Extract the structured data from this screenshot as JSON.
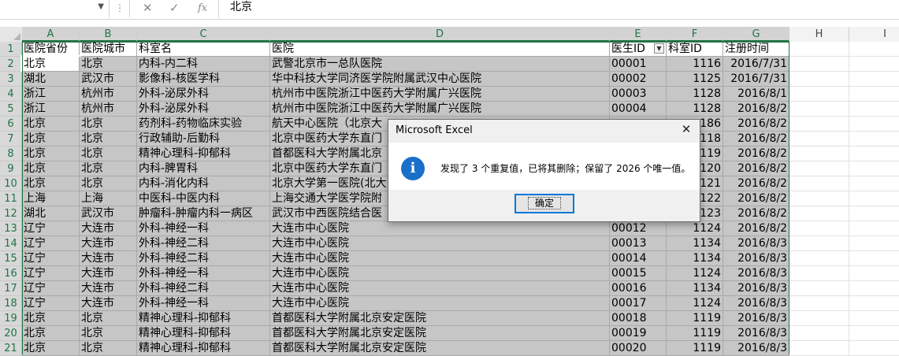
{
  "formula_bar": {
    "name_box": "",
    "cancel_icon": "close-icon",
    "enter_icon": "check-icon",
    "function_label": "fx",
    "value": "北京"
  },
  "columns": [
    "A",
    "B",
    "C",
    "D",
    "E",
    "F",
    "G",
    "H",
    "I"
  ],
  "header_row": {
    "row_num": "1",
    "cells": [
      "医院省份",
      "医院城市",
      "科室名",
      "医院",
      "医生ID",
      "科室ID",
      "注册时间"
    ]
  },
  "rows": [
    {
      "n": "2",
      "c": [
        "北京",
        "北京",
        "内科-内二科",
        "武警北京市一总队医院",
        "00001",
        "1116",
        "2016/7/31"
      ]
    },
    {
      "n": "3",
      "c": [
        "湖北",
        "武汉市",
        "影像科-核医学科",
        "华中科技大学同济医学院附属武汉中心医院",
        "00002",
        "1125",
        "2016/7/31"
      ]
    },
    {
      "n": "4",
      "c": [
        "浙江",
        "杭州市",
        "外科-泌尿外科",
        "杭州市中医院浙江中医药大学附属广兴医院",
        "00003",
        "1128",
        "2016/8/1"
      ]
    },
    {
      "n": "5",
      "c": [
        "浙江",
        "杭州市",
        "外科-泌尿外科",
        "杭州市中医院浙江中医药大学附属广兴医院",
        "00004",
        "1128",
        "2016/8/2"
      ]
    },
    {
      "n": "6",
      "c": [
        "北京",
        "北京",
        "药剂科-药物临床实验",
        "航天中心医院（北京大",
        "",
        "186",
        "2016/8/2"
      ]
    },
    {
      "n": "7",
      "c": [
        "北京",
        "北京",
        "行政辅助-后勤科",
        "北京中医药大学东直门",
        "",
        "118",
        "2016/8/2"
      ]
    },
    {
      "n": "8",
      "c": [
        "北京",
        "北京",
        "精神心理科-抑郁科",
        "首都医科大学附属北京",
        "",
        "119",
        "2016/8/2"
      ]
    },
    {
      "n": "9",
      "c": [
        "北京",
        "北京",
        "内科-脾胃科",
        "北京中医药大学东直门",
        "",
        "120",
        "2016/8/2"
      ]
    },
    {
      "n": "10",
      "c": [
        "北京",
        "北京",
        "内科-消化内科",
        "北京大学第一医院(北大",
        "",
        "121",
        "2016/8/2"
      ]
    },
    {
      "n": "11",
      "c": [
        "上海",
        "上海",
        "中医科-中医内科",
        "上海交通大学医学院附",
        "",
        "122",
        "2016/8/2"
      ]
    },
    {
      "n": "12",
      "c": [
        "湖北",
        "武汉市",
        "肿瘤科-肿瘤内科一病区",
        "武汉市中西医院结合医",
        "",
        "123",
        "2016/8/2"
      ]
    },
    {
      "n": "13",
      "c": [
        "辽宁",
        "大连市",
        "外科-神经一科",
        "大连市中心医院",
        "00012",
        "1124",
        "2016/8/2"
      ]
    },
    {
      "n": "14",
      "c": [
        "辽宁",
        "大连市",
        "外科-神经二科",
        "大连市中心医院",
        "00013",
        "1134",
        "2016/8/3"
      ]
    },
    {
      "n": "15",
      "c": [
        "辽宁",
        "大连市",
        "外科-神经二科",
        "大连市中心医院",
        "00014",
        "1134",
        "2016/8/3"
      ]
    },
    {
      "n": "16",
      "c": [
        "辽宁",
        "大连市",
        "外科-神经一科",
        "大连市中心医院",
        "00015",
        "1124",
        "2016/8/3"
      ]
    },
    {
      "n": "17",
      "c": [
        "辽宁",
        "大连市",
        "外科-神经二科",
        "大连市中心医院",
        "00016",
        "1134",
        "2016/8/3"
      ]
    },
    {
      "n": "18",
      "c": [
        "辽宁",
        "大连市",
        "外科-神经一科",
        "大连市中心医院",
        "00017",
        "1124",
        "2016/8/3"
      ]
    },
    {
      "n": "19",
      "c": [
        "北京",
        "北京",
        "精神心理科-抑郁科",
        "首都医科大学附属北京安定医院",
        "00018",
        "1119",
        "2016/8/3"
      ]
    },
    {
      "n": "20",
      "c": [
        "北京",
        "北京",
        "精神心理科-抑郁科",
        "首都医科大学附属北京安定医院",
        "00019",
        "1119",
        "2016/8/3"
      ]
    },
    {
      "n": "21",
      "c": [
        "北京",
        "北京",
        "精神心理科-抑郁科",
        "首都医科大学附属北京安定医院",
        "00020",
        "1119",
        "2016/8/3"
      ]
    }
  ],
  "dialog": {
    "title": "Microsoft Excel",
    "icon": "info-icon",
    "message": "发现了 3 个重复值，已将其删除；保留了 2026 个唯一值。",
    "ok_label": "确定"
  },
  "colors": {
    "excel_green": "#217346",
    "selection_fill": "#c6c6c6",
    "info_blue": "#1a6fc9",
    "button_focus": "#0078d7"
  }
}
